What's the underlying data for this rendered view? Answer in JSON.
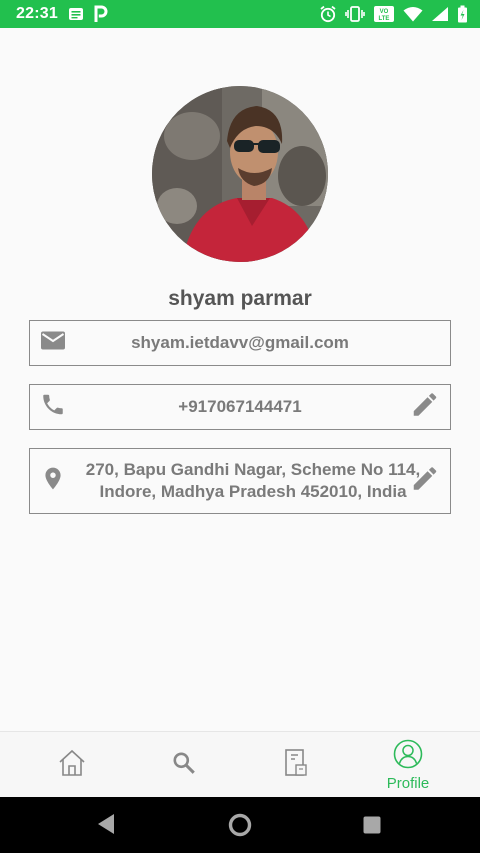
{
  "status_bar": {
    "time": "22:31",
    "volte_label": "VoLTE",
    "icons": [
      "notes-icon",
      "parking-app-icon",
      "alarm-icon",
      "vibrate-icon",
      "volte-icon",
      "wifi-icon",
      "signal-icon",
      "battery-icon"
    ]
  },
  "profile": {
    "name": "shyam parmar",
    "email": "shyam.ietdavv@gmail.com",
    "phone": "+917067144471",
    "address": "270, Bapu Gandhi Nagar, Scheme No 114, Indore, Madhya Pradesh 452010, India"
  },
  "bottom_nav": {
    "items": [
      {
        "icon": "home-icon",
        "label": ""
      },
      {
        "icon": "search-icon",
        "label": ""
      },
      {
        "icon": "orders-icon",
        "label": ""
      },
      {
        "icon": "profile-icon",
        "label": "Profile"
      }
    ],
    "active_index": 3,
    "active_color": "#2dba5a",
    "inactive_color": "#888888"
  },
  "colors": {
    "status_bar": "#22c04e",
    "accent": "#2dba5a",
    "text": "#7a7a7a"
  },
  "system_nav": {
    "icons": [
      "back-icon",
      "home-circle-icon",
      "recents-icon"
    ]
  }
}
